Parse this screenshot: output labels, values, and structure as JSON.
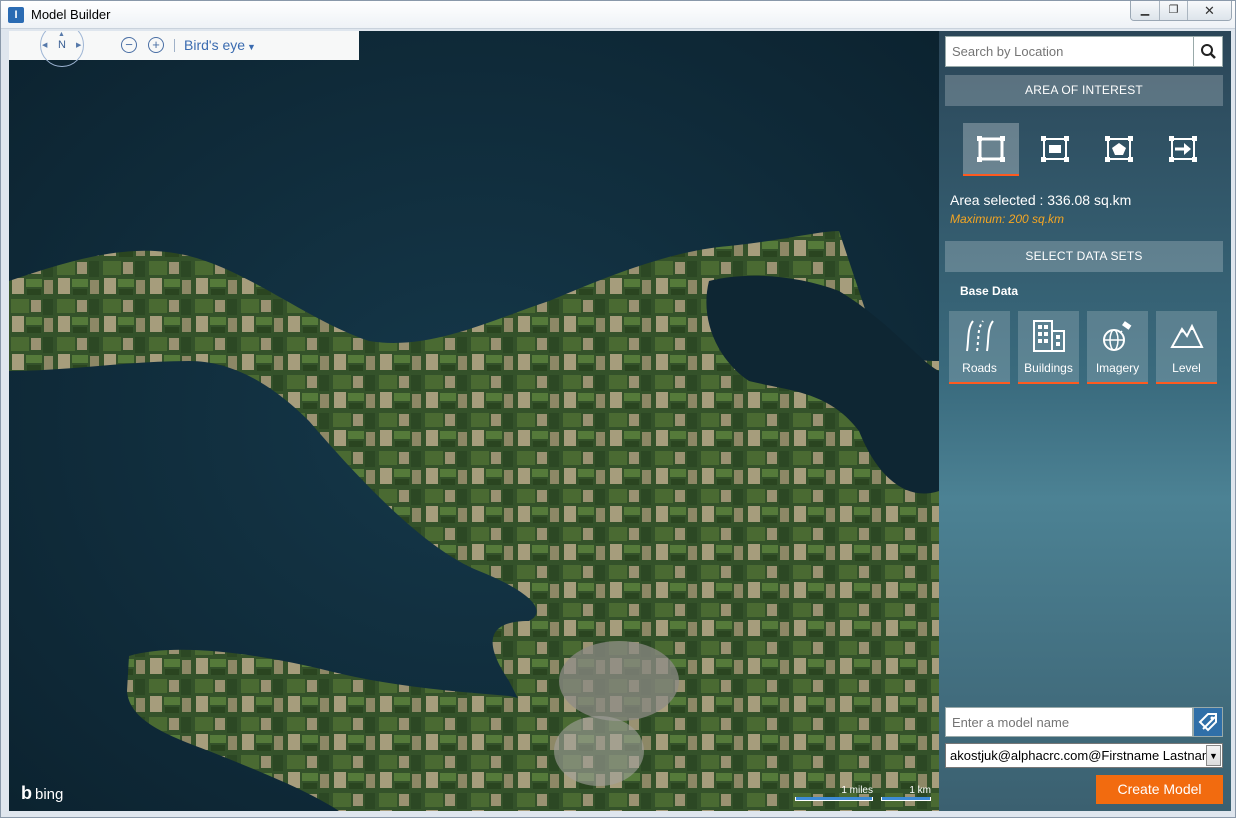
{
  "window": {
    "title": "Model Builder",
    "controls": [
      "minimize",
      "restore",
      "close"
    ]
  },
  "map": {
    "compass_label": "N",
    "view_mode": "Bird's eye",
    "provider": "bing",
    "scale": {
      "miles_label": "1 miles",
      "km_label": "1 km"
    },
    "colors": {
      "water": "#0f2a38",
      "land": "#3e5a2e",
      "field_light": "#8a8a6a"
    }
  },
  "panel": {
    "search": {
      "placeholder": "Search by Location"
    },
    "area_of_interest": {
      "header": "AREA OF INTEREST",
      "tools": [
        "rectangle-select-icon",
        "rectangle-inset-icon",
        "polygon-select-icon",
        "import-area-icon"
      ],
      "active_tool": 0,
      "area_selected": "Area selected : 336.08 sq.km",
      "maximum": "Maximum: 200 sq.km"
    },
    "data_sets": {
      "header": "SELECT DATA SETS",
      "group_label": "Base Data",
      "items": [
        {
          "label": "Roads",
          "icon": "roads-icon"
        },
        {
          "label": "Buildings",
          "icon": "buildings-icon"
        },
        {
          "label": "Imagery",
          "icon": "imagery-icon"
        },
        {
          "label": "Level",
          "icon": "level-icon"
        }
      ]
    },
    "model_name": {
      "placeholder": "Enter a model name"
    },
    "user": {
      "selected": "akostjuk@alphacrc.com@Firstname Lastname"
    },
    "create_button": "Create Model",
    "colors": {
      "accent": "#f26b0f",
      "underline": "#ff5a1f",
      "warning": "#f5a623"
    }
  }
}
